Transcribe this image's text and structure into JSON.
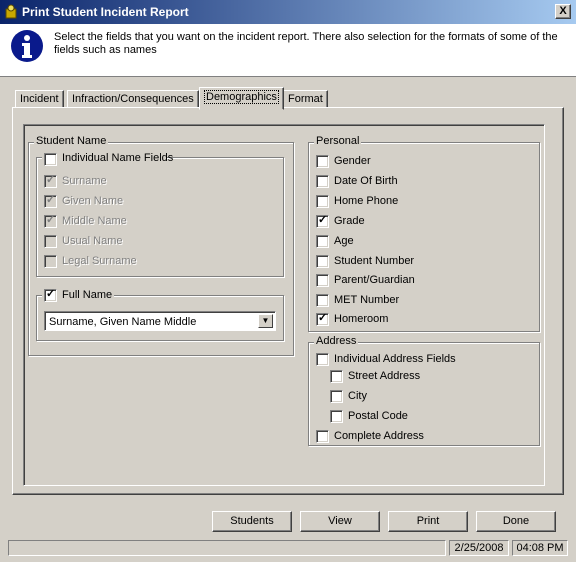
{
  "window": {
    "title": "Print Student Incident Report",
    "close_label": "X"
  },
  "info": {
    "text": "Select the fields that you want on the incident report.  There also selection for the formats of some of the fields such as names"
  },
  "tabs": [
    {
      "label": "Incident"
    },
    {
      "label": "Infraction/Consequences"
    },
    {
      "label": "Demographics"
    },
    {
      "label": "Format"
    }
  ],
  "student_name": {
    "legend": "Student Name",
    "individual": {
      "label": "Individual Name Fields",
      "checked": false,
      "fields": [
        {
          "label": "Surname",
          "checked": true
        },
        {
          "label": "Given Name",
          "checked": true
        },
        {
          "label": "Middle Name",
          "checked": true
        },
        {
          "label": "Usual Name",
          "checked": false
        },
        {
          "label": "Legal Surname",
          "checked": false
        }
      ]
    },
    "full_name": {
      "label": "Full Name",
      "checked": true,
      "format_value": "Surname, Given Name Middle"
    }
  },
  "personal": {
    "legend": "Personal",
    "fields": [
      {
        "label": "Gender",
        "checked": false
      },
      {
        "label": "Date Of Birth",
        "checked": false
      },
      {
        "label": "Home Phone",
        "checked": false
      },
      {
        "label": "Grade",
        "checked": true
      },
      {
        "label": "Age",
        "checked": false
      },
      {
        "label": "Student Number",
        "checked": false
      },
      {
        "label": "Parent/Guardian",
        "checked": false
      },
      {
        "label": "MET Number",
        "checked": false
      },
      {
        "label": "Homeroom",
        "checked": true
      }
    ]
  },
  "address": {
    "legend": "Address",
    "individual": {
      "label": "Individual Address Fields",
      "checked": false
    },
    "fields": [
      {
        "label": "Street Address",
        "checked": false
      },
      {
        "label": "City",
        "checked": false
      },
      {
        "label": "Postal Code",
        "checked": false
      }
    ],
    "complete": {
      "label": "Complete Address",
      "checked": false
    }
  },
  "buttons": {
    "students": "Students",
    "view": "View",
    "print": "Print",
    "done": "Done"
  },
  "status": {
    "date": "2/25/2008",
    "time": "04:08 PM"
  }
}
